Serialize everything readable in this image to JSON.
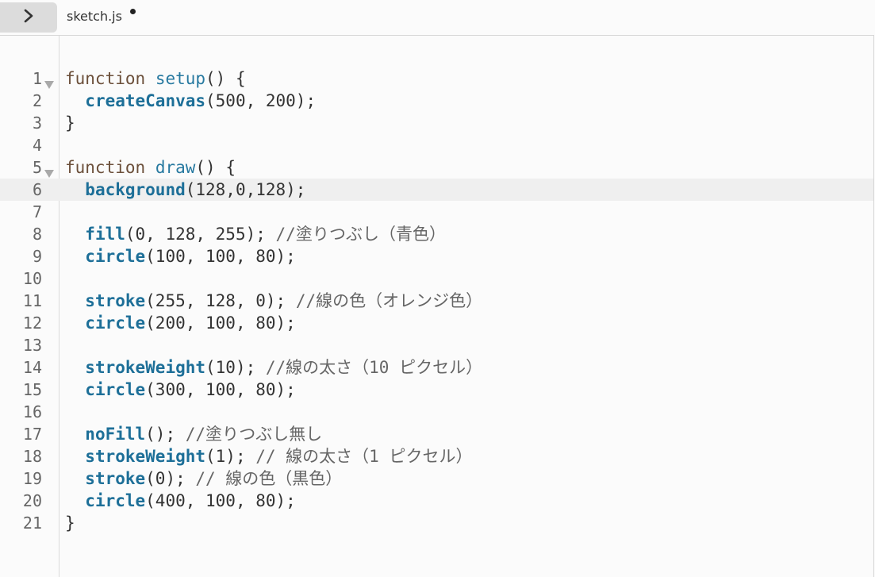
{
  "tabbar": {
    "toggle_icon": "chevron-right-icon",
    "filename": "sketch.js",
    "unsaved": true
  },
  "editor": {
    "active_line": 6,
    "lines": [
      {
        "num": "1",
        "fold": true,
        "tokens": [
          {
            "t": "function",
            "c": "kw"
          },
          {
            "t": " "
          },
          {
            "t": "setup",
            "c": "fnname"
          },
          {
            "t": "() {"
          }
        ]
      },
      {
        "num": "2",
        "tokens": [
          {
            "t": "  "
          },
          {
            "t": "createCanvas",
            "c": "builtin"
          },
          {
            "t": "(500, 200);"
          }
        ]
      },
      {
        "num": "3",
        "tokens": [
          {
            "t": "}"
          }
        ]
      },
      {
        "num": "4",
        "tokens": []
      },
      {
        "num": "5",
        "fold": true,
        "tokens": [
          {
            "t": "function",
            "c": "kw"
          },
          {
            "t": " "
          },
          {
            "t": "draw",
            "c": "fnname"
          },
          {
            "t": "() {"
          }
        ]
      },
      {
        "num": "6",
        "tokens": [
          {
            "t": "  "
          },
          {
            "t": "background",
            "c": "builtin"
          },
          {
            "t": "(128,0,128);"
          }
        ]
      },
      {
        "num": "7",
        "tokens": []
      },
      {
        "num": "8",
        "tokens": [
          {
            "t": "  "
          },
          {
            "t": "fill",
            "c": "builtin"
          },
          {
            "t": "(0, 128, 255); "
          },
          {
            "t": "//塗りつぶし（青色）",
            "c": "cm"
          }
        ]
      },
      {
        "num": "9",
        "tokens": [
          {
            "t": "  "
          },
          {
            "t": "circle",
            "c": "builtin"
          },
          {
            "t": "(100, 100, 80);"
          }
        ]
      },
      {
        "num": "10",
        "tokens": []
      },
      {
        "num": "11",
        "tokens": [
          {
            "t": "  "
          },
          {
            "t": "stroke",
            "c": "builtin"
          },
          {
            "t": "(255, 128, 0); "
          },
          {
            "t": "//線の色（オレンジ色）",
            "c": "cm"
          }
        ]
      },
      {
        "num": "12",
        "tokens": [
          {
            "t": "  "
          },
          {
            "t": "circle",
            "c": "builtin"
          },
          {
            "t": "(200, 100, 80);"
          }
        ]
      },
      {
        "num": "13",
        "tokens": []
      },
      {
        "num": "14",
        "tokens": [
          {
            "t": "  "
          },
          {
            "t": "strokeWeight",
            "c": "builtin"
          },
          {
            "t": "(10); "
          },
          {
            "t": "//線の太さ（10 ピクセル）",
            "c": "cm"
          }
        ]
      },
      {
        "num": "15",
        "tokens": [
          {
            "t": "  "
          },
          {
            "t": "circle",
            "c": "builtin"
          },
          {
            "t": "(300, 100, 80);"
          }
        ]
      },
      {
        "num": "16",
        "tokens": []
      },
      {
        "num": "17",
        "tokens": [
          {
            "t": "  "
          },
          {
            "t": "noFill",
            "c": "builtin"
          },
          {
            "t": "(); "
          },
          {
            "t": "//塗りつぶし無し",
            "c": "cm"
          }
        ]
      },
      {
        "num": "18",
        "tokens": [
          {
            "t": "  "
          },
          {
            "t": "strokeWeight",
            "c": "builtin"
          },
          {
            "t": "(1); "
          },
          {
            "t": "// 線の太さ（1 ピクセル）",
            "c": "cm"
          }
        ]
      },
      {
        "num": "19",
        "tokens": [
          {
            "t": "  "
          },
          {
            "t": "stroke",
            "c": "builtin"
          },
          {
            "t": "(0); "
          },
          {
            "t": "// 線の色（黒色）",
            "c": "cm"
          }
        ]
      },
      {
        "num": "20",
        "tokens": [
          {
            "t": "  "
          },
          {
            "t": "circle",
            "c": "builtin"
          },
          {
            "t": "(400, 100, 80);"
          }
        ]
      },
      {
        "num": "21",
        "tokens": [
          {
            "t": "}"
          }
        ]
      }
    ]
  }
}
